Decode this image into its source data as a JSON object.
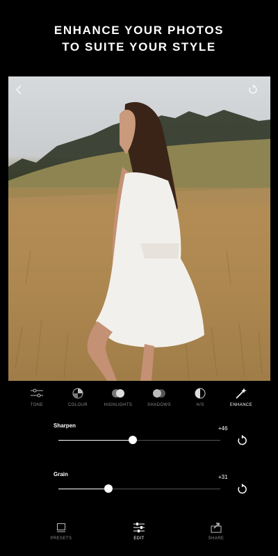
{
  "headline": {
    "line1": "ENHANCE YOUR PHOTOS",
    "line2": "TO SUITE YOUR STYLE"
  },
  "photo": {
    "back_icon": "chevron-left-icon",
    "reset_icon": "reset-icon"
  },
  "tools": [
    {
      "label": "TONE",
      "icon": "sliders-icon",
      "active": false
    },
    {
      "label": "COLOUR",
      "icon": "color-wheel-icon",
      "active": false
    },
    {
      "label": "HIGHLIGHTS",
      "icon": "highlights-icon",
      "active": false
    },
    {
      "label": "SHADOWS",
      "icon": "shadows-icon",
      "active": false
    },
    {
      "label": "H/S",
      "icon": "half-circle-icon",
      "active": false
    },
    {
      "label": "ENHANCE",
      "icon": "magic-wand-icon",
      "active": true
    }
  ],
  "adjustments": [
    {
      "label": "Sharpen",
      "value": "+46",
      "level": 0.46
    },
    {
      "label": "Grain",
      "value": "+31",
      "level": 0.31
    }
  ],
  "bottom_nav": [
    {
      "label": "PRESETS",
      "icon": "presets-icon",
      "active": false
    },
    {
      "label": "EDIT",
      "icon": "edit-sliders-icon",
      "active": true
    },
    {
      "label": "SHARE",
      "icon": "share-icon",
      "active": false
    }
  ],
  "colors": {
    "background": "#000000",
    "text": "#ffffff",
    "inactive_label": "#8c8c8c",
    "track": "#555555"
  }
}
